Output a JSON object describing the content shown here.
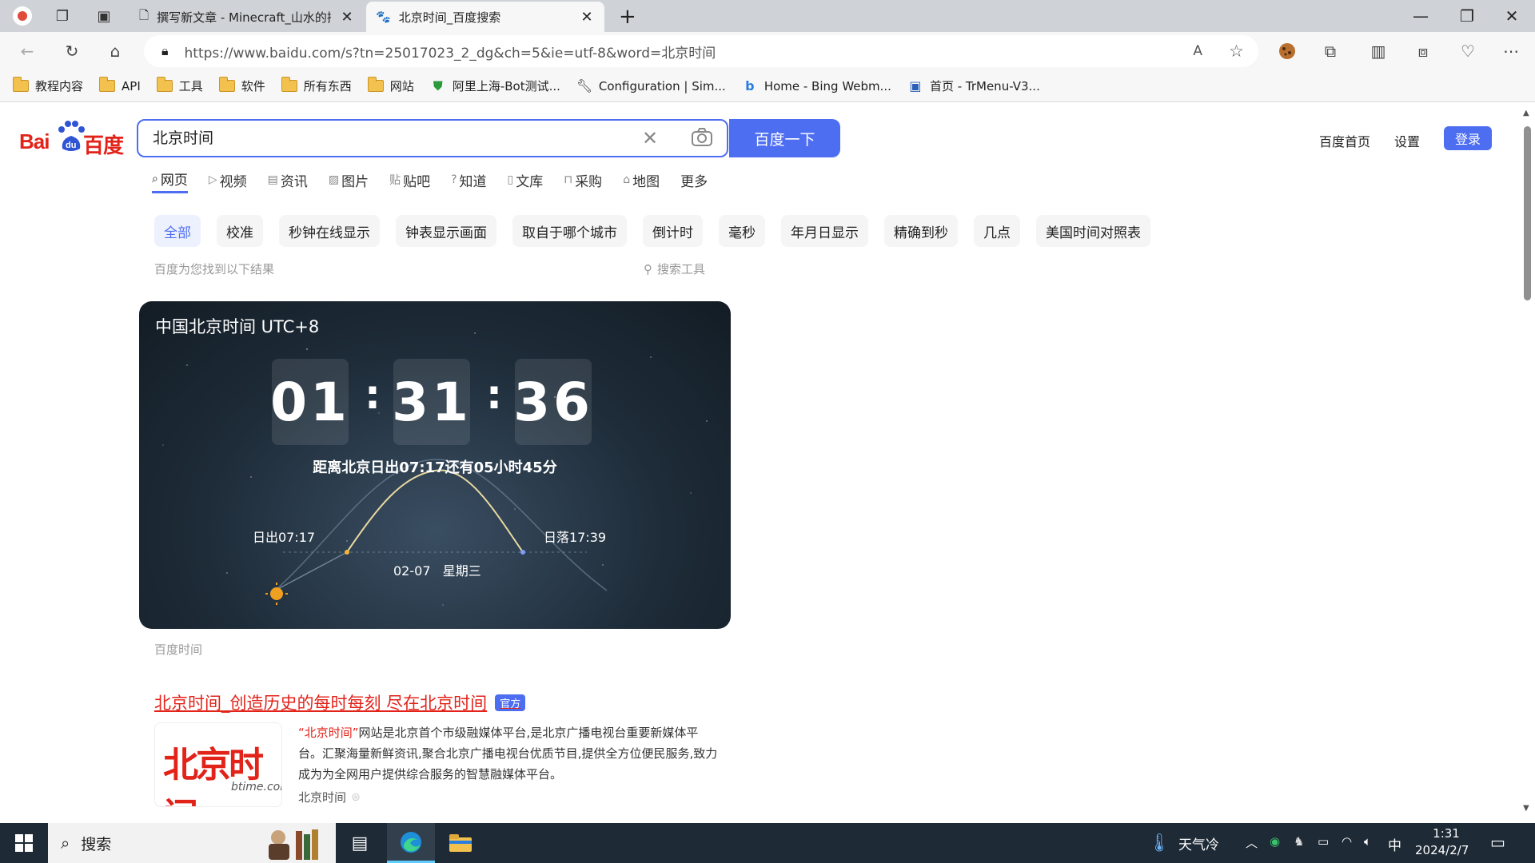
{
  "browser": {
    "tabs": [
      {
        "title": "撰写新文章 - Minecraft_山水的插",
        "icon": "document-icon"
      },
      {
        "title": "北京时间_百度搜索",
        "icon": "baidu-paw-icon"
      }
    ],
    "url": "https://www.baidu.com/s?tn=25017023_2_dg&ch=5&ie=utf-8&word=北京时间",
    "bookmarks": [
      {
        "label": "教程内容",
        "icon": "folder-icon"
      },
      {
        "label": "API",
        "icon": "folder-icon"
      },
      {
        "label": "工具",
        "icon": "folder-icon"
      },
      {
        "label": "软件",
        "icon": "folder-icon"
      },
      {
        "label": "所有东西",
        "icon": "folder-icon"
      },
      {
        "label": "网站",
        "icon": "folder-icon"
      },
      {
        "label": "阿里上海-Bot测试...",
        "icon": "shield-icon"
      },
      {
        "label": "Configuration | Sim...",
        "icon": "wrench-icon"
      },
      {
        "label": "Home - Bing Webm...",
        "icon": "bing-icon"
      },
      {
        "label": "首页 - TrMenu-V3...",
        "icon": "page-icon"
      }
    ]
  },
  "baidu": {
    "logo_left": "Bai",
    "logo_right": "百度",
    "search_query": "北京时间",
    "search_button": "百度一下",
    "top_links": {
      "home": "百度首页",
      "settings": "设置",
      "login": "登录"
    },
    "nav_tabs": [
      {
        "label": "网页",
        "icon": "search-icon",
        "glyph": "⌕",
        "active": true
      },
      {
        "label": "视频",
        "icon": "video-icon",
        "glyph": "▷",
        "active": false
      },
      {
        "label": "资讯",
        "icon": "news-icon",
        "glyph": "▤",
        "active": false
      },
      {
        "label": "图片",
        "icon": "image-icon",
        "glyph": "▨",
        "active": false
      },
      {
        "label": "贴吧",
        "icon": "tieba-icon",
        "glyph": "贴",
        "active": false
      },
      {
        "label": "知道",
        "icon": "question-icon",
        "glyph": "?",
        "active": false
      },
      {
        "label": "文库",
        "icon": "doc-icon",
        "glyph": "▯",
        "active": false
      },
      {
        "label": "采购",
        "icon": "cart-icon",
        "glyph": "⊓",
        "active": false
      },
      {
        "label": "地图",
        "icon": "map-icon",
        "glyph": "⌂",
        "active": false
      },
      {
        "label": "更多",
        "icon": "",
        "glyph": "",
        "active": false
      }
    ],
    "chips": [
      "全部",
      "校准",
      "秒钟在线显示",
      "钟表显示画面",
      "取自于哪个城市",
      "倒计时",
      "毫秒",
      "年月日显示",
      "精确到秒",
      "几点",
      "美国时间对照表"
    ],
    "result_count": "百度为您找到以下结果",
    "search_tools": "搜索工具",
    "clock_card": {
      "title": "中国北京时间 UTC+8",
      "hours": "01",
      "minutes": "31",
      "seconds": "36",
      "sunrise_note": "距离北京日出07:17还有05小时45分",
      "sunrise": "日出07:17",
      "sunset": "日落17:39",
      "date": "02-07   星期三",
      "source": "百度时间"
    },
    "result": {
      "title": "北京时间_创造历史的每时每刻 尽在北京时间",
      "badge": "官方",
      "desc_highlight": "“北京时间”",
      "desc": "网站是北京首个市级融媒体平台,是北京广播电视台重要新媒体平台。汇聚海量新鲜资讯,聚合北京广播电视台优质节目,提供全方位便民服务,致力成为为全网用户提供综合服务的智慧融媒体平台。",
      "site": "北京时间",
      "thumb_logo": "北京时间",
      "thumb_sub": "btime.com"
    }
  },
  "taskbar": {
    "search_label": "搜索",
    "weather": "天气冷",
    "ime": "中",
    "time": "1:31",
    "date": "2024/2/7"
  }
}
